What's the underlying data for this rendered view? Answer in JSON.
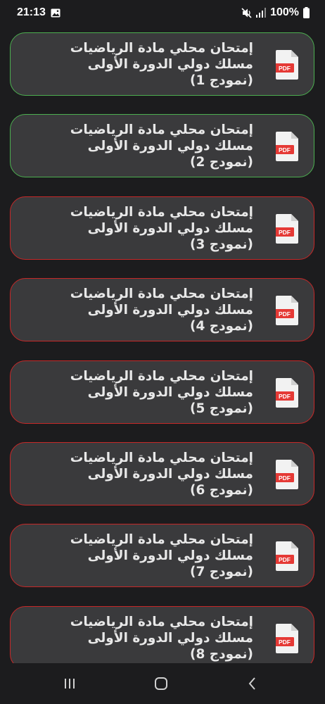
{
  "status_bar": {
    "time": "21:13",
    "battery": "100%",
    "icons": [
      "gallery-icon",
      "mute-icon",
      "signal-icon",
      "battery-icon"
    ]
  },
  "cards": [
    {
      "title": "إمتحان محلي مادة الرياضيات\nمسلك دولي الدورة الأولى\n(نمودج 1)",
      "border": "green",
      "badge": "PDF"
    },
    {
      "title": "إمتحان محلي مادة الرياضيات\nمسلك دولي الدورة الأولى\n(نمودج 2)",
      "border": "green",
      "badge": "PDF"
    },
    {
      "title": "إمتحان محلي مادة الرياضيات\nمسلك دولي الدورة الأولى\n(نمودج 3)",
      "border": "red",
      "badge": "PDF"
    },
    {
      "title": "إمتحان محلي مادة الرياضيات\nمسلك دولي الدورة الأولى\n(نمودج 4)",
      "border": "red",
      "badge": "PDF"
    },
    {
      "title": "إمتحان محلي مادة الرياضيات\nمسلك دولي الدورة الأولى\n(نمودج 5)",
      "border": "red",
      "badge": "PDF"
    },
    {
      "title": "إمتحان محلي مادة الرياضيات\nمسلك دولي الدورة الأولى\n(نمودج 6)",
      "border": "red",
      "badge": "PDF"
    },
    {
      "title": "إمتحان محلي مادة الرياضيات\nمسلك دولي الدورة الأولى\n(نمودج 7)",
      "border": "red",
      "badge": "PDF"
    },
    {
      "title": "إمتحان محلي مادة الرياضيات\nمسلك دولي الدورة الأولى\n(نمودج 8)",
      "border": "red",
      "badge": "PDF"
    }
  ],
  "colors": {
    "background": "#1c1c1e",
    "card": "#3a3a3c",
    "border_green": "#4caf50",
    "border_red": "#c62828",
    "pdf_red": "#e53935"
  },
  "nav_bar": {
    "buttons": [
      "recent-apps-icon",
      "home-icon",
      "back-icon"
    ]
  }
}
